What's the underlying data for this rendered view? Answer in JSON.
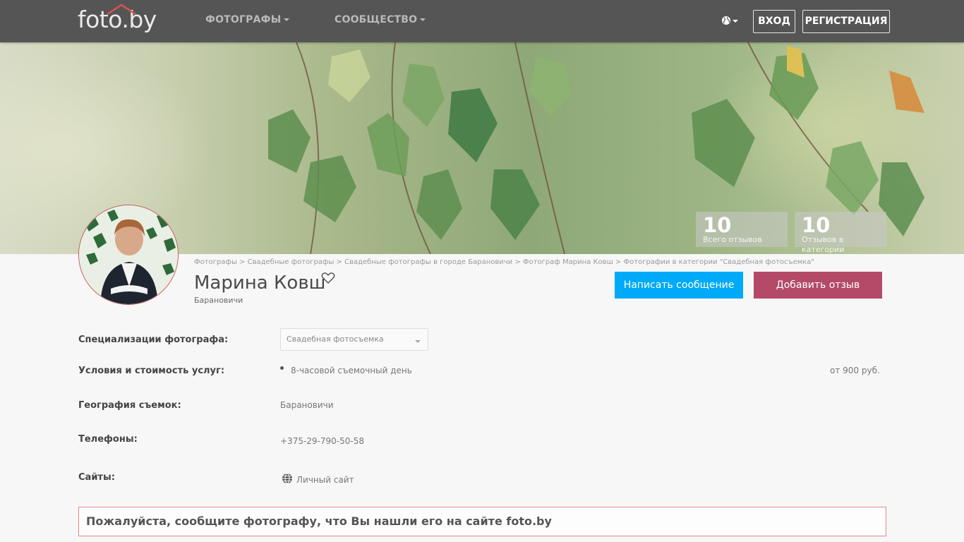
{
  "header": {
    "logo_text": "foto.by",
    "nav": [
      {
        "label": "ФОТОГРАФЫ"
      },
      {
        "label": "СООБЩЕСТВО"
      }
    ],
    "login_label": "ВХОД",
    "register_label": "РЕГИСТРАЦИЯ"
  },
  "stats": [
    {
      "value": "10",
      "label": "Всего отзывов"
    },
    {
      "value": "10",
      "label": "Отзывов в категории"
    }
  ],
  "breadcrumb": "Фотографы > Свадебные фотографы > Свадебные фотографы в городе Барановичи > Фотограф Марина Ковш > Фотографии в категории \"Свадебная фотосъемка\"",
  "profile": {
    "name": "Марина Ковш",
    "city": "Барановичи"
  },
  "actions": {
    "message_label": "Написать сообщение",
    "review_label": "Добавить отзыв"
  },
  "details": {
    "specialization_label": "Специализации фотографа:",
    "specialization_value": "Свадебная фотосъемка",
    "services_label": "Условия и стоимость услуг:",
    "service_item": "8-часовой съемочный день",
    "service_price": "от 900 руб.",
    "geo_label": "География съемок:",
    "geo_value": "Барановичи",
    "phones_label": "Телефоны:",
    "phone_value": "+375-29-790-50-58",
    "sites_label": "Сайты:",
    "site_value": "Личный сайт"
  },
  "notice": "Пожалуйста, сообщите фотографу, что Вы нашли его на сайте foto.by",
  "colors": {
    "header_bg": "#555555",
    "message_btn": "#00aaf7",
    "review_btn": "#b34a68",
    "notice_border": "#e28a8a"
  }
}
